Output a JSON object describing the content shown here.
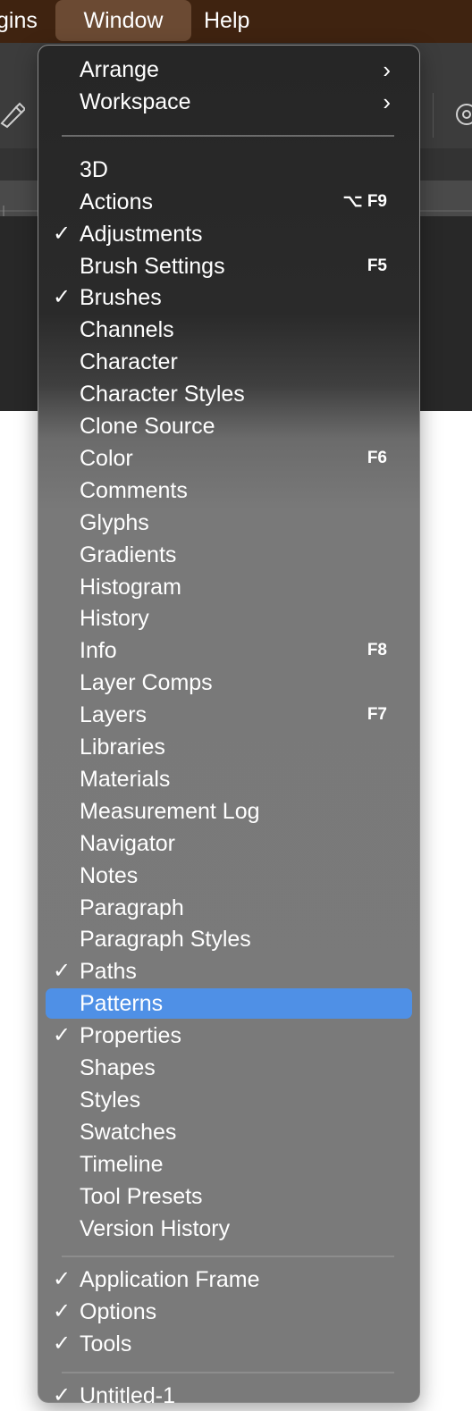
{
  "menubar": {
    "items": [
      "gins",
      "Window",
      "Help"
    ]
  },
  "menu": {
    "top": [
      {
        "label": "Arrange",
        "submenu": true
      },
      {
        "label": "Workspace",
        "submenu": true
      }
    ],
    "panels": [
      {
        "label": "3D",
        "checked": false,
        "shortcut": ""
      },
      {
        "label": "Actions",
        "checked": false,
        "shortcut": "⌥ F9"
      },
      {
        "label": "Adjustments",
        "checked": true,
        "shortcut": ""
      },
      {
        "label": "Brush Settings",
        "checked": false,
        "shortcut": "F5"
      },
      {
        "label": "Brushes",
        "checked": true,
        "shortcut": ""
      },
      {
        "label": "Channels",
        "checked": false,
        "shortcut": ""
      },
      {
        "label": "Character",
        "checked": false,
        "shortcut": ""
      },
      {
        "label": "Character Styles",
        "checked": false,
        "shortcut": ""
      },
      {
        "label": "Clone Source",
        "checked": false,
        "shortcut": ""
      },
      {
        "label": "Color",
        "checked": false,
        "shortcut": "F6"
      },
      {
        "label": "Comments",
        "checked": false,
        "shortcut": ""
      },
      {
        "label": "Glyphs",
        "checked": false,
        "shortcut": ""
      },
      {
        "label": "Gradients",
        "checked": false,
        "shortcut": ""
      },
      {
        "label": "Histogram",
        "checked": false,
        "shortcut": ""
      },
      {
        "label": "History",
        "checked": false,
        "shortcut": ""
      },
      {
        "label": "Info",
        "checked": false,
        "shortcut": "F8"
      },
      {
        "label": "Layer Comps",
        "checked": false,
        "shortcut": ""
      },
      {
        "label": "Layers",
        "checked": false,
        "shortcut": "F7"
      },
      {
        "label": "Libraries",
        "checked": false,
        "shortcut": ""
      },
      {
        "label": "Materials",
        "checked": false,
        "shortcut": ""
      },
      {
        "label": "Measurement Log",
        "checked": false,
        "shortcut": ""
      },
      {
        "label": "Navigator",
        "checked": false,
        "shortcut": ""
      },
      {
        "label": "Notes",
        "checked": false,
        "shortcut": ""
      },
      {
        "label": "Paragraph",
        "checked": false,
        "shortcut": ""
      },
      {
        "label": "Paragraph Styles",
        "checked": false,
        "shortcut": ""
      },
      {
        "label": "Paths",
        "checked": true,
        "shortcut": ""
      },
      {
        "label": "Patterns",
        "checked": false,
        "shortcut": "",
        "highlighted": true
      },
      {
        "label": "Properties",
        "checked": true,
        "shortcut": ""
      },
      {
        "label": "Shapes",
        "checked": false,
        "shortcut": ""
      },
      {
        "label": "Styles",
        "checked": false,
        "shortcut": ""
      },
      {
        "label": "Swatches",
        "checked": false,
        "shortcut": ""
      },
      {
        "label": "Timeline",
        "checked": false,
        "shortcut": ""
      },
      {
        "label": "Tool Presets",
        "checked": false,
        "shortcut": ""
      },
      {
        "label": "Version History",
        "checked": false,
        "shortcut": ""
      }
    ],
    "frame": [
      {
        "label": "Application Frame",
        "checked": true
      },
      {
        "label": "Options",
        "checked": true
      },
      {
        "label": "Tools",
        "checked": true
      }
    ],
    "documents": [
      {
        "label": "Untitled-1",
        "checked": true
      }
    ],
    "check_glyph": "✓",
    "chevron_glyph": "›"
  },
  "colors": {
    "highlight": "#4f90e6",
    "menubar": "#3f2310"
  }
}
